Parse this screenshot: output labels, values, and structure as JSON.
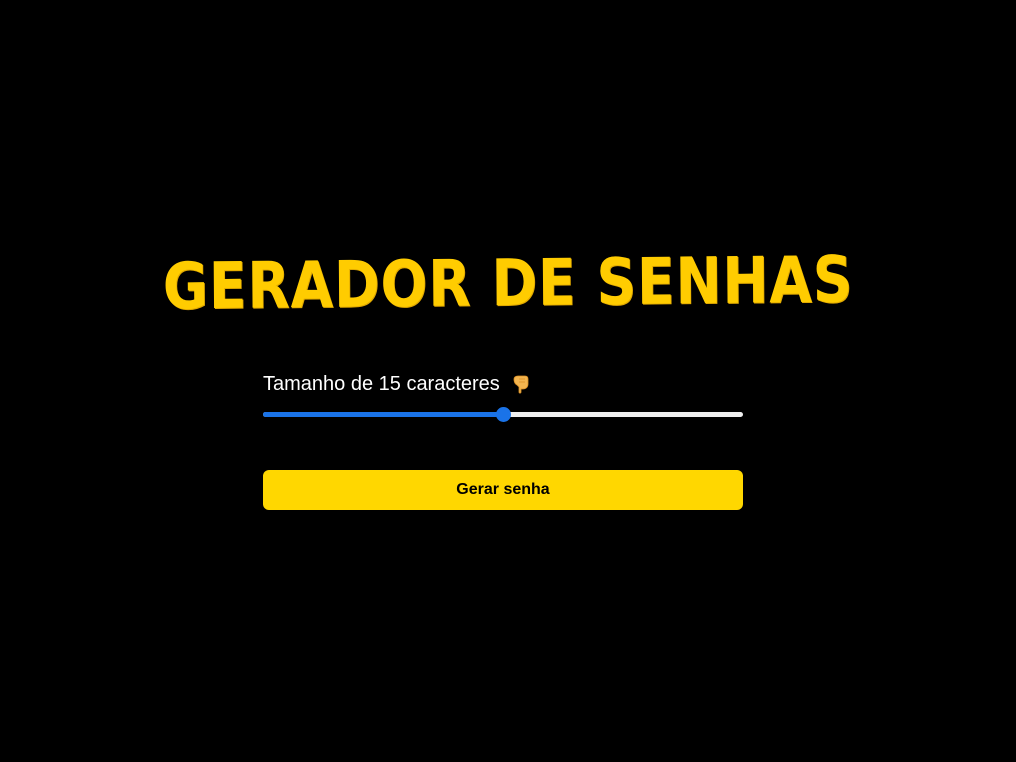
{
  "header": {
    "title": "GERADOR DE SENHAS"
  },
  "length_control": {
    "label": "Tamanho de 15 caracteres",
    "icon": "pointing-down-hand-icon",
    "value": 15,
    "fill_fraction": 0.5
  },
  "actions": {
    "generate_label": "Gerar senha"
  },
  "colors": {
    "background": "#000000",
    "title": "#ffcc00",
    "slider_accent": "#1a73e8",
    "slider_track": "#efefef",
    "button": "#ffd700",
    "button_text": "#000000"
  }
}
